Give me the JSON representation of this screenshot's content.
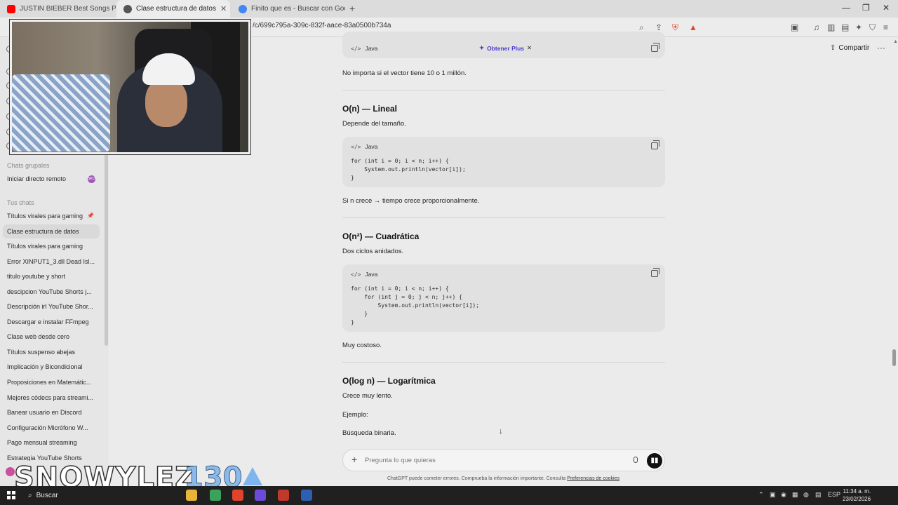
{
  "browser": {
    "tabs": [
      {
        "title": "JUSTIN BIEBER Best Songs Playlis",
        "favicon_color": "#ff0000"
      },
      {
        "title": "Clase estructura de datos",
        "favicon_color": "#555555"
      },
      {
        "title": "Finito que es - Buscar con Google",
        "favicon_color": "#4285f4"
      }
    ],
    "address": "/c/699c795a-309c-832f-aace-83a0500b734a"
  },
  "header": {
    "share_label": "Compartir",
    "upgrade_label": "Obtener Plus"
  },
  "sidebar": {
    "group_heading": "Chats grupales",
    "group_item": "Iniciar directo remoto",
    "group_avatar": "SKO",
    "chats_heading": "Tus chats",
    "chats": [
      "Títulos virales para gaming",
      "Clase estructura de datos",
      "Títulos virales para gaming",
      "Error XINPUT1_3.dll Dead Isl...",
      "titulo youtube y short",
      "descipcion YouTube Shorts j...",
      "Descripción irl YouTube Shor...",
      "Descargar e instalar FFmpeg",
      "Clase web desde cero",
      "Títulos suspenso abejas",
      "Implicación y Bicondicional",
      "Proposiciones en Matemátic...",
      "Mejores códecs para streami...",
      "Banear usuario en Discord",
      "Configuración Micrófono W...",
      "Pago mensual streaming",
      "Estrategia YouTube Shorts"
    ]
  },
  "content": {
    "code_lang": "Java",
    "p_constant": "No importa si el vector tiene 10 o 1 millón.",
    "h_linear": "O(n) — Lineal",
    "p_linear": "Depende del tamaño.",
    "code_linear": [
      "for (int i = 0; i < n; i++) {",
      "    System.out.println(vector[i]);",
      "}"
    ],
    "p_linear_after": "Si n crece → tiempo crece proporcionalmente.",
    "h_quadratic": "O(n²) — Cuadrática",
    "p_quadratic": "Dos ciclos anidados.",
    "code_quadratic": [
      "for (int i = 0; i < n; i++) {",
      "    for (int j = 0; j < n; j++) {",
      "        System.out.println(vector[i]);",
      "    }",
      "}"
    ],
    "p_quadratic_after": "Muy costoso.",
    "h_log": "O(log n) — Logarítmica",
    "p_log": "Crece muy lento.",
    "p_example": "Ejemplo:",
    "p_binary": "Búsqueda binaria."
  },
  "composer": {
    "placeholder": "Pregunta lo que quieras",
    "disclaimer": "ChatGPT puede cometer errores. Comprueba la información importante. Consulta",
    "disclaimer_link": "Preferencias de cookies"
  },
  "overlay": {
    "name": "SNOWYLEZ",
    "number": "130"
  },
  "taskbar": {
    "search_label": "Buscar",
    "language": "ESP",
    "time": "11:34 a. m.",
    "date": "23/02/2026"
  }
}
